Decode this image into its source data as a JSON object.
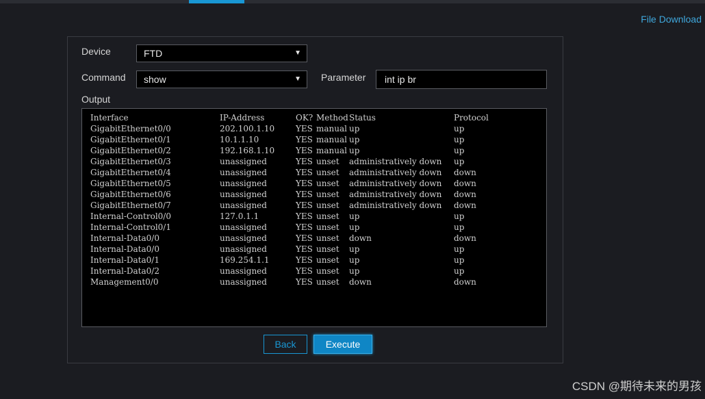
{
  "header": {
    "file_download": "File Download"
  },
  "form": {
    "device_label": "Device",
    "device_value": "FTD",
    "command_label": "Command",
    "command_value": "show",
    "parameter_label": "Parameter",
    "parameter_value": "int ip br",
    "output_label": "Output"
  },
  "output": {
    "header": [
      "Interface",
      "IP-Address",
      "OK?",
      "Method",
      "Status",
      "Protocol"
    ],
    "rows": [
      [
        "GigabitEthernet0/0",
        "202.100.1.10",
        "YES",
        "manual",
        "up",
        "up"
      ],
      [
        "GigabitEthernet0/1",
        "10.1.1.10",
        "YES",
        "manual",
        "up",
        "up"
      ],
      [
        "GigabitEthernet0/2",
        "192.168.1.10",
        "YES",
        "manual",
        "up",
        "up"
      ],
      [
        "GigabitEthernet0/3",
        "unassigned",
        "YES",
        "unset",
        "administratively down",
        "up"
      ],
      [
        "GigabitEthernet0/4",
        "unassigned",
        "YES",
        "unset",
        "administratively down",
        "down"
      ],
      [
        "GigabitEthernet0/5",
        "unassigned",
        "YES",
        "unset",
        "administratively down",
        "down"
      ],
      [
        "GigabitEthernet0/6",
        "unassigned",
        "YES",
        "unset",
        "administratively down",
        "down"
      ],
      [
        "GigabitEthernet0/7",
        "unassigned",
        "YES",
        "unset",
        "administratively down",
        "down"
      ],
      [
        "Internal-Control0/0",
        "127.0.1.1",
        "YES",
        "unset",
        "up",
        "up"
      ],
      [
        "Internal-Control0/1",
        "unassigned",
        "YES",
        "unset",
        "up",
        "up"
      ],
      [
        "Internal-Data0/0",
        "unassigned",
        "YES",
        "unset",
        "down",
        "down"
      ],
      [
        "Internal-Data0/0",
        "unassigned",
        "YES",
        "unset",
        "up",
        "up"
      ],
      [
        "Internal-Data0/1",
        "169.254.1.1",
        "YES",
        "unset",
        "up",
        "up"
      ],
      [
        "Internal-Data0/2",
        "unassigned",
        "YES",
        "unset",
        "up",
        "up"
      ],
      [
        "Management0/0",
        "unassigned",
        "YES",
        "unset",
        "down",
        "down"
      ]
    ]
  },
  "buttons": {
    "back": "Back",
    "execute": "Execute"
  },
  "watermark": "CSDN @期待未来的男孩",
  "icons": {
    "dropdown": "chevron-down-icon"
  },
  "colors": {
    "accent": "#1997d4",
    "background": "#1b1c21",
    "link": "#3fa7dc"
  }
}
